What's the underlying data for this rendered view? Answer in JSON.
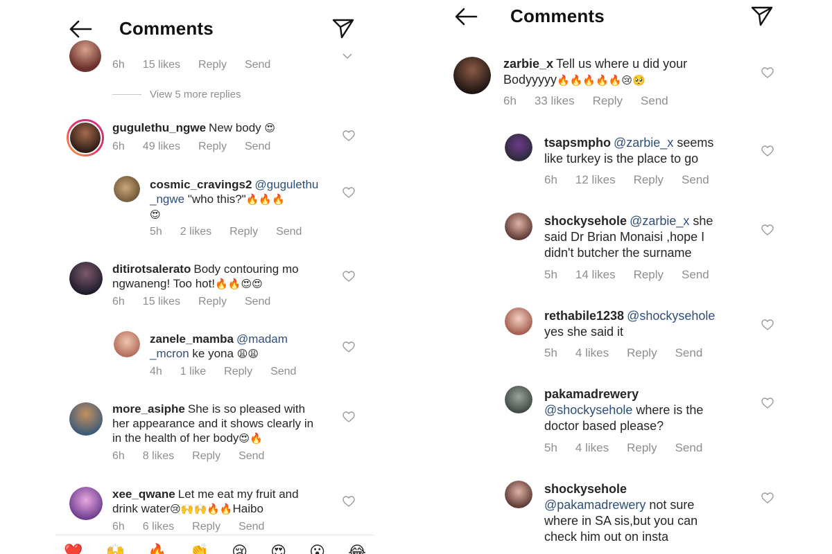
{
  "left": {
    "title": "Comments",
    "top_partial": {
      "time": "6h",
      "likes": "15 likes",
      "reply": "Reply",
      "send": "Send"
    },
    "view_more": "View 5 more replies",
    "comments": [
      {
        "user": "gugulethu_ngwe",
        "text": "New body ",
        "emoji": "😍",
        "time": "6h",
        "likes": "49 likes"
      },
      {
        "user": "cosmic_cravings2",
        "mention": "@gugulethu_ngwe",
        "mention_a": "@gugulethu",
        "mention_b": "_ngwe",
        "text": " \"who this?\"",
        "emoji": "🔥🔥🔥",
        "emoji2": "😍",
        "time": "5h",
        "likes": "2 likes"
      },
      {
        "user": "ditirotsalerato",
        "text": "Body contouring mo",
        "text2": "ngwaneng! Too hot!",
        "emoji": "🔥🔥😍😍",
        "time": "6h",
        "likes": "15 likes"
      },
      {
        "user": "zanele_mamba",
        "mention_a": "@madam",
        "mention_b": "_mcron",
        "text": " ke yona ",
        "emoji": "😩😩",
        "time": "4h",
        "likes": "1 like"
      },
      {
        "user": "more_asiphe",
        "text": "She is so pleased with",
        "text2": "her appearance and it shows clearly in",
        "text3": "in the health of her body",
        "emoji": "😍🔥",
        "time": "6h",
        "likes": "8 likes"
      },
      {
        "user": "xee_qwane",
        "text": "Let me eat my fruit and",
        "text2": "drink water",
        "emoji": "😢🙌🙌🔥🔥",
        "text3": "Haibo",
        "time": "6h",
        "likes": "6 likes"
      }
    ],
    "emoji_bar": [
      "❤️",
      "🙌",
      "🔥",
      "👏",
      "😢",
      "😍",
      "😮",
      "😂"
    ],
    "reply": "Reply",
    "send": "Send"
  },
  "right": {
    "title": "Comments",
    "comments": [
      {
        "user": "zarbie_x",
        "text": "Tell us where u did your",
        "text2": "Bodyyyyy",
        "emoji": "🔥🔥🔥🔥🔥😢🥺",
        "time": "6h",
        "likes": "33 likes"
      },
      {
        "user": "tsapsmpho",
        "mention": "@zarbie_x",
        "text": " seems",
        "text2": "like turkey is the place to go",
        "time": "6h",
        "likes": "12 likes"
      },
      {
        "user": "shockysehole",
        "mention": "@zarbie_x",
        "text": " she",
        "text2": "said Dr Brian Monaisi ,hope I",
        "text3": "didn't butcher the surname",
        "time": "5h",
        "likes": "14 likes"
      },
      {
        "user": "rethabile1238",
        "mention": "@shockysehole",
        "text2": "yes she said it",
        "time": "5h",
        "likes": "4 likes"
      },
      {
        "user": "pakamadrewery",
        "mention": "@shockysehole",
        "text": " where is the",
        "text2": "doctor based please?",
        "time": "5h",
        "likes": "4 likes"
      },
      {
        "user": "shockysehole",
        "mention": "@pakamadrewery",
        "text": " not sure",
        "text2": "where in SA sis,but you can",
        "text3": "check him out on insta"
      }
    ],
    "reply": "Reply",
    "send": "Send"
  },
  "colors": {
    "mention": "#2e4e7a",
    "meta": "#8e8e8e",
    "text": "#262626"
  },
  "icons": [
    "back-arrow-icon",
    "paper-plane-icon",
    "heart-outline-icon"
  ]
}
